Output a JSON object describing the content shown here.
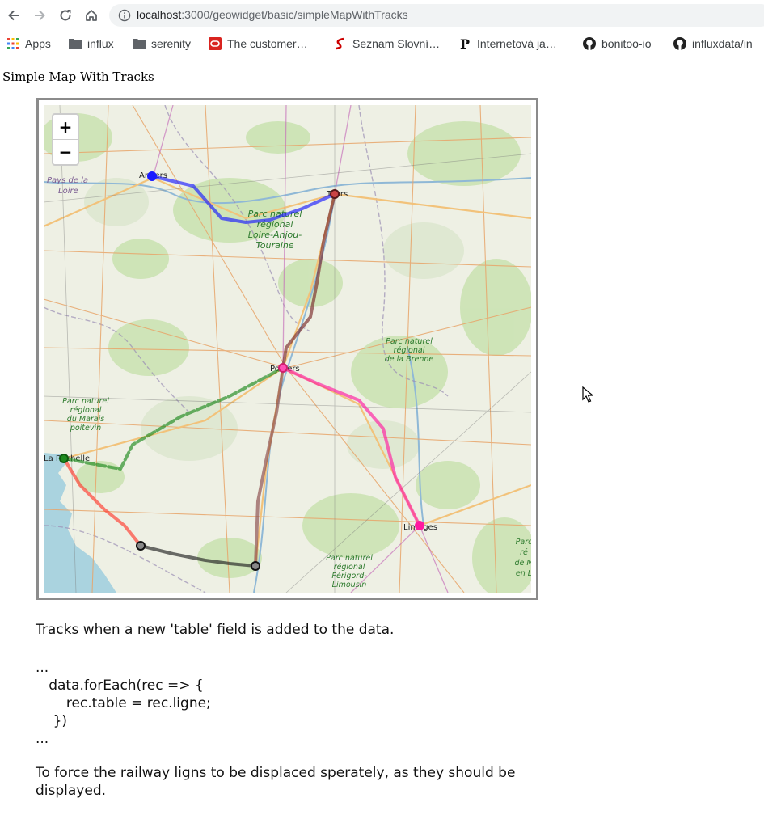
{
  "browser": {
    "url_host": "localhost",
    "url_path": ":3000/geowidget/basic/simpleMapWithTracks",
    "bookmarks": [
      {
        "label": "Apps",
        "icon": "apps-grid-icon"
      },
      {
        "label": "influx",
        "icon": "folder-icon"
      },
      {
        "label": "serenity",
        "icon": "folder-icon"
      },
      {
        "label": "The customer…",
        "icon": "oracle-icon"
      },
      {
        "label": "Seznam Slovní…",
        "icon": "seznam-icon"
      },
      {
        "label": "Internetová ja…",
        "icon": "p-logo-icon"
      },
      {
        "label": "bonitoo-io",
        "icon": "github-icon"
      },
      {
        "label": "influxdata/in",
        "icon": "github-icon"
      }
    ]
  },
  "page": {
    "title": "Simple Map With Tracks",
    "description": "Tracks when a new 'table' field is added to the data.",
    "code": "...\n   data.forEach(rec => {\n       rec.table = rec.ligne;\n    })\n...",
    "footer": "To force the railway ligns to be displaced sperately, as they should be\ndisplayed."
  },
  "map": {
    "zoom_in": "+",
    "zoom_out": "−",
    "cities": {
      "angers": "Angers",
      "tours": "Tours",
      "poitiers": "Poitiers",
      "la_rochelle": "La Rochelle",
      "limoges": "Limoges"
    },
    "regions": {
      "pays_de_la_loire_1": "Pays de la",
      "pays_de_la_loire_2": "Loire",
      "pnr_loire_1": "Parc naturel",
      "pnr_loire_2": "régional",
      "pnr_loire_3": "Loire-Anjou-",
      "pnr_loire_4": "Touraine",
      "pnr_brenne_1": "Parc naturel",
      "pnr_brenne_2": "régional",
      "pnr_brenne_3": "de la Brenne",
      "pnr_marais_1": "Parc naturel",
      "pnr_marais_2": "régional",
      "pnr_marais_3": "du Marais",
      "pnr_marais_4": "poitevin",
      "pnr_perigord_1": "Parc naturel",
      "pnr_perigord_2": "régional",
      "pnr_perigord_3": "Périgord-",
      "pnr_perigord_4": "Limousin",
      "pnr_edge_1": "Parc",
      "pnr_edge_2": "ré",
      "pnr_edge_3": "de M",
      "pnr_edge_4": "en L"
    },
    "track_colors": {
      "blue": "#1a1aff",
      "darkred": "#7a2a2a",
      "green": "#1e8a1e",
      "red": "#ff3b2f",
      "pink": "#ff1aa0",
      "black": "#222222"
    }
  }
}
